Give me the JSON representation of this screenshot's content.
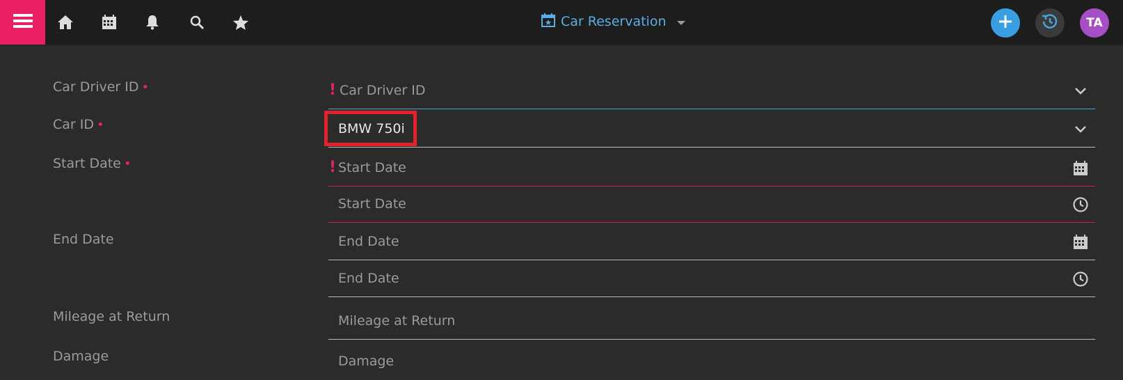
{
  "header": {
    "title": "Car Reservation",
    "accent_color": "#e91e63",
    "title_color": "#5aaee6",
    "nav_icons": [
      "menu-icon",
      "home-icon",
      "calendar-icon",
      "bell-icon",
      "search-icon",
      "star-icon",
      "calendar-star-icon",
      "caret-down-icon",
      "plus-icon",
      "history-icon"
    ],
    "avatar_initials": "TA"
  },
  "form": {
    "car_driver_id": {
      "label": "Car Driver ID",
      "placeholder": "Car Driver ID",
      "required": true,
      "error": true
    },
    "car_id": {
      "label": "Car ID",
      "value": "BMW 750i",
      "required": true
    },
    "start_date": {
      "label": "Start Date",
      "date_placeholder": "Start Date",
      "time_placeholder": "Start Date",
      "required": true,
      "error": true
    },
    "end_date": {
      "label": "End Date",
      "date_placeholder": "End Date",
      "time_placeholder": "End Date"
    },
    "mileage": {
      "label": "Mileage at Return",
      "placeholder": "Mileage at Return"
    },
    "damage": {
      "label": "Damage",
      "placeholder": "Damage"
    },
    "required_marker": "•",
    "error_marker": "!"
  }
}
